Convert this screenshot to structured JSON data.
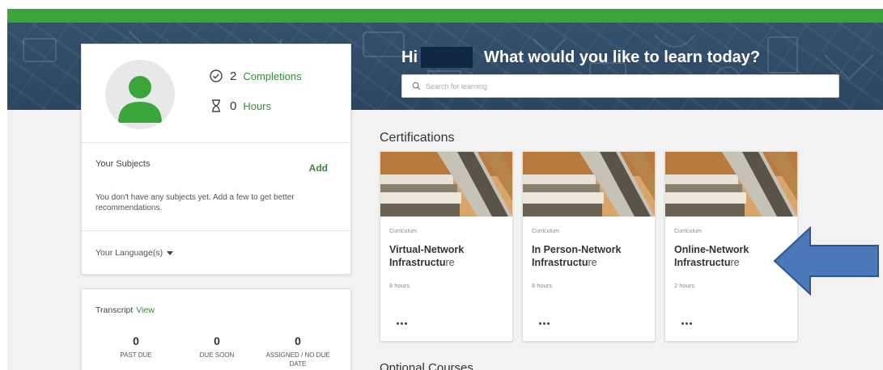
{
  "profile": {
    "completions_count": "2",
    "completions_label": "Completions",
    "hours_count": "0",
    "hours_label": "Hours"
  },
  "subjects": {
    "title": "Your Subjects",
    "add_label": "Add",
    "empty_message": "You don't have any subjects yet. Add a few to get better recommendations."
  },
  "language": {
    "label": "Your Language(s)"
  },
  "transcript": {
    "title": "Transcript",
    "view_label": "View",
    "stats": [
      {
        "count": "0",
        "label": "PAST DUE"
      },
      {
        "count": "0",
        "label": "DUE SOON"
      },
      {
        "count": "0",
        "label": "ASSIGNED / NO DUE DATE"
      }
    ]
  },
  "greeting": {
    "hi": "Hi",
    "question": "What would you like to learn today?"
  },
  "search": {
    "placeholder": "Search for learning"
  },
  "certifications": {
    "title": "Certifications",
    "courses": [
      {
        "type": "Curriculum",
        "title_bold": "Virtual-Network Infrastructu",
        "title_light": "re",
        "duration": "8 hours"
      },
      {
        "type": "Curriculum",
        "title_bold": "In Person-Network Infrastructu",
        "title_light": "re",
        "duration": "8 hours"
      },
      {
        "type": "Curriculum",
        "title_bold": "Online-Network Infrastructu",
        "title_light": "re",
        "duration": "2 hours"
      }
    ]
  },
  "optional_courses": {
    "title": "Optional Courses"
  },
  "colors": {
    "brand_green": "#3aa53a",
    "banner_navy": "#2e4a66",
    "arrow_blue": "#4a78b8"
  }
}
